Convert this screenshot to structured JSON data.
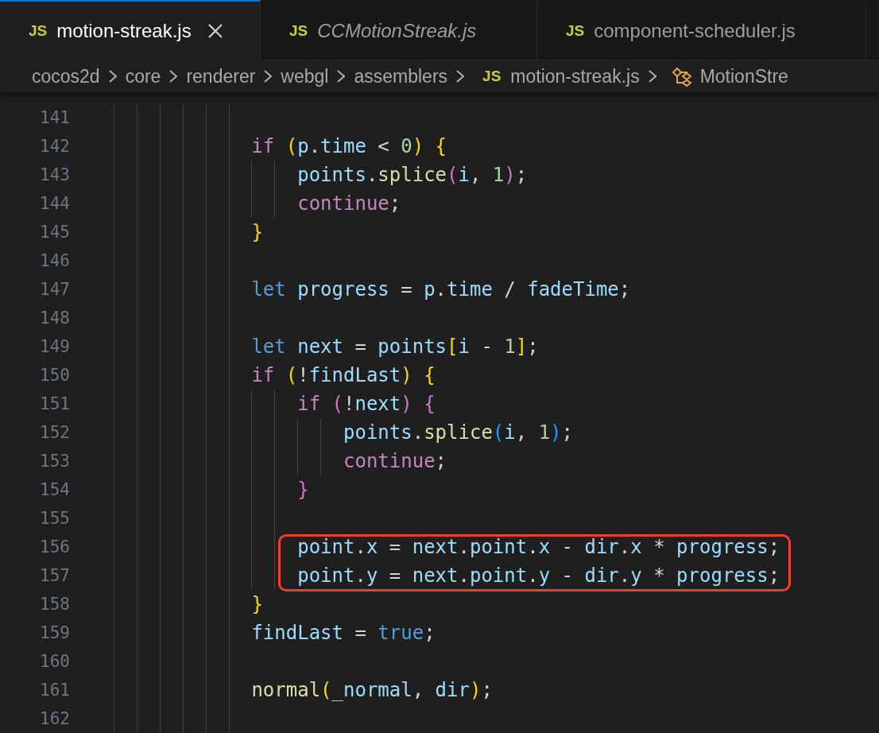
{
  "tabs": [
    {
      "icon": "JS",
      "label": "motion-streak.js",
      "selected": true,
      "preview": false
    },
    {
      "icon": "JS",
      "label": "CCMotionStreak.js",
      "selected": false,
      "preview": true
    },
    {
      "icon": "JS",
      "label": "component-scheduler.js",
      "selected": false,
      "preview": false
    }
  ],
  "breadcrumb": [
    {
      "kind": "folder",
      "text": "cocos2d"
    },
    {
      "kind": "folder",
      "text": "core"
    },
    {
      "kind": "folder",
      "text": "renderer"
    },
    {
      "kind": "folder",
      "text": "webgl"
    },
    {
      "kind": "folder",
      "text": "assemblers"
    },
    {
      "kind": "file",
      "icon": "JS",
      "text": "motion-streak.js"
    },
    {
      "kind": "symbol",
      "text": "MotionStre"
    }
  ],
  "lines": [
    {
      "number": "141"
    },
    {
      "number": "142",
      "tokens": [
        {
          "kind": "kw",
          "text": "            if"
        },
        {
          "kind": "b1",
          "text": " ("
        },
        {
          "kind": "var",
          "text": "p"
        },
        {
          "kind": "op",
          "text": "."
        },
        {
          "kind": "var",
          "text": "time"
        },
        {
          "kind": "op",
          "text": " < "
        },
        {
          "kind": "num",
          "text": "0"
        },
        {
          "kind": "b1",
          "text": ")"
        },
        {
          "kind": "b1",
          "text": " {"
        }
      ]
    },
    {
      "number": "143",
      "tokens": [
        {
          "kind": "var",
          "text": "                points"
        },
        {
          "kind": "op",
          "text": "."
        },
        {
          "kind": "fn",
          "text": "splice"
        },
        {
          "kind": "b2",
          "text": "("
        },
        {
          "kind": "var",
          "text": "i"
        },
        {
          "kind": "op",
          "text": ", "
        },
        {
          "kind": "num",
          "text": "1"
        },
        {
          "kind": "b2",
          "text": ")"
        },
        {
          "kind": "op",
          "text": ";"
        }
      ]
    },
    {
      "number": "144",
      "tokens": [
        {
          "kind": "kw",
          "text": "                continue"
        },
        {
          "kind": "op",
          "text": ";"
        }
      ]
    },
    {
      "number": "145",
      "tokens": [
        {
          "kind": "b1",
          "text": "            }"
        }
      ]
    },
    {
      "number": "146"
    },
    {
      "number": "147",
      "tokens": [
        {
          "kind": "decl",
          "text": "            let"
        },
        {
          "kind": "var",
          "text": " progress"
        },
        {
          "kind": "op",
          "text": " = "
        },
        {
          "kind": "var",
          "text": "p"
        },
        {
          "kind": "op",
          "text": "."
        },
        {
          "kind": "var",
          "text": "time"
        },
        {
          "kind": "op",
          "text": " / "
        },
        {
          "kind": "var",
          "text": "fadeTime"
        },
        {
          "kind": "op",
          "text": ";"
        }
      ]
    },
    {
      "number": "148"
    },
    {
      "number": "149",
      "tokens": [
        {
          "kind": "decl",
          "text": "            let"
        },
        {
          "kind": "var",
          "text": " next"
        },
        {
          "kind": "op",
          "text": " = "
        },
        {
          "kind": "var",
          "text": "points"
        },
        {
          "kind": "b1",
          "text": "["
        },
        {
          "kind": "var",
          "text": "i"
        },
        {
          "kind": "op",
          "text": " - "
        },
        {
          "kind": "num",
          "text": "1"
        },
        {
          "kind": "b1",
          "text": "]"
        },
        {
          "kind": "op",
          "text": ";"
        }
      ]
    },
    {
      "number": "150",
      "tokens": [
        {
          "kind": "kw",
          "text": "            if"
        },
        {
          "kind": "b1",
          "text": " ("
        },
        {
          "kind": "op",
          "text": "!"
        },
        {
          "kind": "var",
          "text": "findLast"
        },
        {
          "kind": "b1",
          "text": ")"
        },
        {
          "kind": "b1",
          "text": " {"
        }
      ]
    },
    {
      "number": "151",
      "tokens": [
        {
          "kind": "kw",
          "text": "                if"
        },
        {
          "kind": "b2",
          "text": " ("
        },
        {
          "kind": "op",
          "text": "!"
        },
        {
          "kind": "var",
          "text": "next"
        },
        {
          "kind": "b2",
          "text": ")"
        },
        {
          "kind": "b2",
          "text": " {"
        }
      ]
    },
    {
      "number": "152",
      "tokens": [
        {
          "kind": "var",
          "text": "                    points"
        },
        {
          "kind": "op",
          "text": "."
        },
        {
          "kind": "fn",
          "text": "splice"
        },
        {
          "kind": "b3",
          "text": "("
        },
        {
          "kind": "var",
          "text": "i"
        },
        {
          "kind": "op",
          "text": ", "
        },
        {
          "kind": "num",
          "text": "1"
        },
        {
          "kind": "b3",
          "text": ")"
        },
        {
          "kind": "op",
          "text": ";"
        }
      ]
    },
    {
      "number": "153",
      "tokens": [
        {
          "kind": "kw",
          "text": "                    continue"
        },
        {
          "kind": "op",
          "text": ";"
        }
      ]
    },
    {
      "number": "154",
      "tokens": [
        {
          "kind": "b2",
          "text": "                }"
        }
      ]
    },
    {
      "number": "155"
    },
    {
      "number": "156",
      "highlighted": true,
      "tokens": [
        {
          "kind": "var",
          "text": "                point"
        },
        {
          "kind": "op",
          "text": "."
        },
        {
          "kind": "var",
          "text": "x"
        },
        {
          "kind": "op",
          "text": " = "
        },
        {
          "kind": "var",
          "text": "next"
        },
        {
          "kind": "op",
          "text": "."
        },
        {
          "kind": "var",
          "text": "point"
        },
        {
          "kind": "op",
          "text": "."
        },
        {
          "kind": "var",
          "text": "x"
        },
        {
          "kind": "op",
          "text": " - "
        },
        {
          "kind": "var",
          "text": "dir"
        },
        {
          "kind": "op",
          "text": "."
        },
        {
          "kind": "var",
          "text": "x"
        },
        {
          "kind": "op",
          "text": " * "
        },
        {
          "kind": "var",
          "text": "progress"
        },
        {
          "kind": "op",
          "text": ";"
        }
      ]
    },
    {
      "number": "157",
      "highlighted": true,
      "tokens": [
        {
          "kind": "var",
          "text": "                point"
        },
        {
          "kind": "op",
          "text": "."
        },
        {
          "kind": "var",
          "text": "y"
        },
        {
          "kind": "op",
          "text": " = "
        },
        {
          "kind": "var",
          "text": "next"
        },
        {
          "kind": "op",
          "text": "."
        },
        {
          "kind": "var",
          "text": "point"
        },
        {
          "kind": "op",
          "text": "."
        },
        {
          "kind": "var",
          "text": "y"
        },
        {
          "kind": "op",
          "text": " - "
        },
        {
          "kind": "var",
          "text": "dir"
        },
        {
          "kind": "op",
          "text": "."
        },
        {
          "kind": "var",
          "text": "y"
        },
        {
          "kind": "op",
          "text": " * "
        },
        {
          "kind": "var",
          "text": "progress"
        },
        {
          "kind": "op",
          "text": ";"
        }
      ]
    },
    {
      "number": "158",
      "tokens": [
        {
          "kind": "b1",
          "text": "            }"
        }
      ]
    },
    {
      "number": "159",
      "tokens": [
        {
          "kind": "var",
          "text": "            findLast"
        },
        {
          "kind": "op",
          "text": " = "
        },
        {
          "kind": "decl",
          "text": "true"
        },
        {
          "kind": "op",
          "text": ";"
        }
      ]
    },
    {
      "number": "160"
    },
    {
      "number": "161",
      "tokens": [
        {
          "kind": "fn",
          "text": "            normal"
        },
        {
          "kind": "b1",
          "text": "("
        },
        {
          "kind": "var",
          "text": "_normal"
        },
        {
          "kind": "op",
          "text": ", "
        },
        {
          "kind": "var",
          "text": "dir"
        },
        {
          "kind": "b1",
          "text": ")"
        },
        {
          "kind": "op",
          "text": ";"
        }
      ]
    },
    {
      "number": "162"
    }
  ]
}
